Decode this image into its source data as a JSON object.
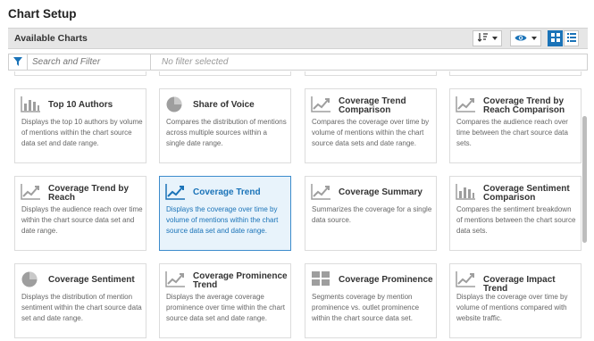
{
  "title": "Chart Setup",
  "toolbar": {
    "label": "Available Charts"
  },
  "search": {
    "placeholder": "Search and Filter",
    "status": "No filter selected"
  },
  "colors": {
    "accent": "#1a73b8",
    "selected_bg": "#e8f3fb",
    "icon_gray": "#9e9e9e"
  },
  "cards": [
    {
      "title": "Top 10 Authors",
      "icon": "bar-chart-icon",
      "desc": "Displays the top 10 authors by volume of mentions within the chart source data set and date range."
    },
    {
      "title": "Share of Voice",
      "icon": "pie-chart-icon",
      "desc": "Compares the distribution of mentions across multiple sources within a single date range."
    },
    {
      "title": "Coverage Trend Comparison",
      "icon": "line-chart-icon",
      "desc": "Compares the coverage over time by volume of mentions within the chart source data sets and date range."
    },
    {
      "title": "Coverage Trend by Reach Comparison",
      "icon": "line-chart-icon",
      "desc": "Compares the audience reach over time between the chart source data sets."
    },
    {
      "title": "Coverage Trend by Reach",
      "icon": "line-chart-icon",
      "desc": "Displays the audience reach over time within the chart source data set and date range."
    },
    {
      "title": "Coverage Trend",
      "icon": "line-chart-icon",
      "desc": "Displays the coverage over time by volume of mentions within the chart source data set and date range.",
      "selected": true
    },
    {
      "title": "Coverage Summary",
      "icon": "line-chart-icon",
      "desc": "Summarizes the coverage for a single data source."
    },
    {
      "title": "Coverage Sentiment Comparison",
      "icon": "bar-chart-icon",
      "desc": "Compares the sentiment breakdown of mentions between the chart source data sets."
    },
    {
      "title": "Coverage Sentiment",
      "icon": "pie-chart-icon",
      "desc": "Displays the distribution of mention sentiment within the chart source data set and date range."
    },
    {
      "title": "Coverage Prominence Trend",
      "icon": "line-chart-icon",
      "desc": "Displays the average coverage prominence over time within the chart source data set and date range."
    },
    {
      "title": "Coverage Prominence",
      "icon": "tiles-icon",
      "desc": "Segments coverage by mention prominence vs. outlet prominence within the chart source data set."
    },
    {
      "title": "Coverage Impact Trend",
      "icon": "line-chart-icon",
      "desc": "Displays the coverage over time by volume of mentions compared with website traffic."
    }
  ]
}
